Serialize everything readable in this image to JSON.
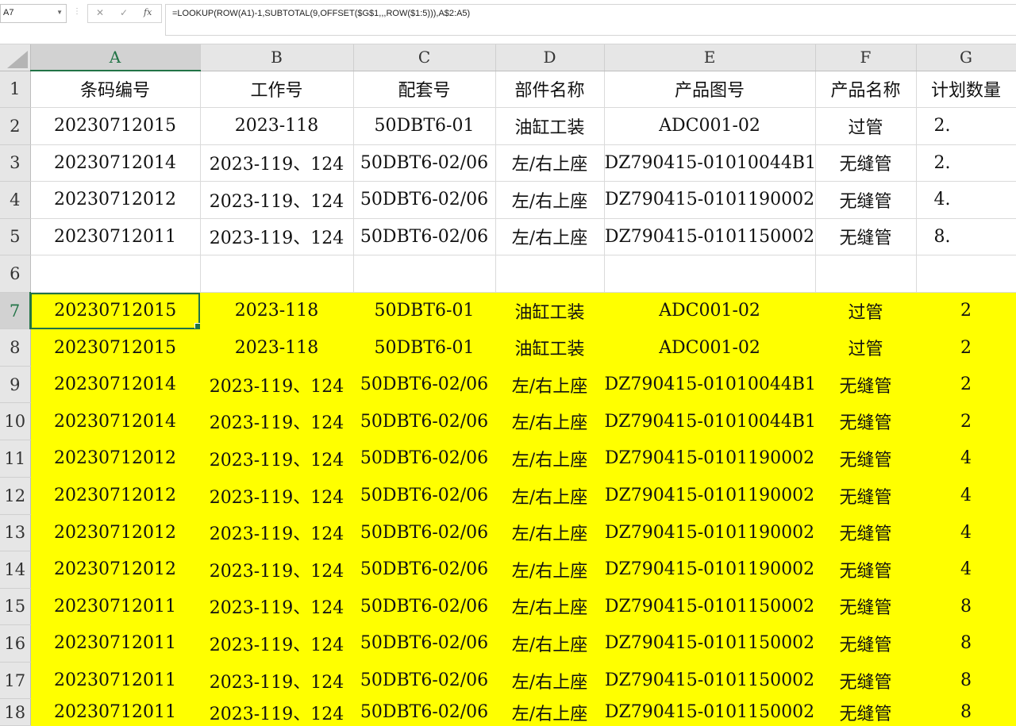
{
  "formula_bar": {
    "name_box": "A7",
    "cancel_icon": "✕",
    "enter_icon": "✓",
    "function_icon": "fx",
    "formula": "=LOOKUP(ROW(A1)-1,SUBTOTAL(9,OFFSET($G$1,,,ROW($1:5))),A$2:A5)"
  },
  "columns": [
    "A",
    "B",
    "C",
    "D",
    "E",
    "F",
    "G"
  ],
  "active_column": "A",
  "active_row": "7",
  "rows": [
    {
      "num": "1",
      "highlight": false,
      "cells": [
        "条码编号",
        "工作号",
        "配套号",
        "部件名称",
        "产品图号",
        "产品名称",
        "计划数量"
      ]
    },
    {
      "num": "2",
      "highlight": false,
      "cells": [
        "20230712015",
        "2023-118",
        "50DBT6-01",
        "油缸工装",
        "ADC001-02",
        "过管",
        "2."
      ]
    },
    {
      "num": "3",
      "highlight": false,
      "cells": [
        "20230712014",
        "2023-119、124",
        "50DBT6-02/06",
        "左/右上座",
        "DZ790415-01010044B1",
        "无缝管",
        "2."
      ]
    },
    {
      "num": "4",
      "highlight": false,
      "cells": [
        "20230712012",
        "2023-119、124",
        "50DBT6-02/06",
        "左/右上座",
        "DZ790415-0101190002",
        "无缝管",
        "4."
      ]
    },
    {
      "num": "5",
      "highlight": false,
      "cells": [
        "20230712011",
        "2023-119、124",
        "50DBT6-02/06",
        "左/右上座",
        "DZ790415-0101150002",
        "无缝管",
        "8."
      ]
    },
    {
      "num": "6",
      "highlight": false,
      "cells": [
        "",
        "",
        "",
        "",
        "",
        "",
        ""
      ]
    },
    {
      "num": "7",
      "highlight": true,
      "cells": [
        "20230712015",
        "2023-118",
        "50DBT6-01",
        "油缸工装",
        "ADC001-02",
        "过管",
        "2"
      ]
    },
    {
      "num": "8",
      "highlight": true,
      "cells": [
        "20230712015",
        "2023-118",
        "50DBT6-01",
        "油缸工装",
        "ADC001-02",
        "过管",
        "2"
      ]
    },
    {
      "num": "9",
      "highlight": true,
      "cells": [
        "20230712014",
        "2023-119、124",
        "50DBT6-02/06",
        "左/右上座",
        "DZ790415-01010044B1",
        "无缝管",
        "2"
      ]
    },
    {
      "num": "10",
      "highlight": true,
      "cells": [
        "20230712014",
        "2023-119、124",
        "50DBT6-02/06",
        "左/右上座",
        "DZ790415-01010044B1",
        "无缝管",
        "2"
      ]
    },
    {
      "num": "11",
      "highlight": true,
      "cells": [
        "20230712012",
        "2023-119、124",
        "50DBT6-02/06",
        "左/右上座",
        "DZ790415-0101190002",
        "无缝管",
        "4"
      ]
    },
    {
      "num": "12",
      "highlight": true,
      "cells": [
        "20230712012",
        "2023-119、124",
        "50DBT6-02/06",
        "左/右上座",
        "DZ790415-0101190002",
        "无缝管",
        "4"
      ]
    },
    {
      "num": "13",
      "highlight": true,
      "cells": [
        "20230712012",
        "2023-119、124",
        "50DBT6-02/06",
        "左/右上座",
        "DZ790415-0101190002",
        "无缝管",
        "4"
      ]
    },
    {
      "num": "14",
      "highlight": true,
      "cells": [
        "20230712012",
        "2023-119、124",
        "50DBT6-02/06",
        "左/右上座",
        "DZ790415-0101190002",
        "无缝管",
        "4"
      ]
    },
    {
      "num": "15",
      "highlight": true,
      "cells": [
        "20230712011",
        "2023-119、124",
        "50DBT6-02/06",
        "左/右上座",
        "DZ790415-0101150002",
        "无缝管",
        "8"
      ]
    },
    {
      "num": "16",
      "highlight": true,
      "cells": [
        "20230712011",
        "2023-119、124",
        "50DBT6-02/06",
        "左/右上座",
        "DZ790415-0101150002",
        "无缝管",
        "8"
      ]
    },
    {
      "num": "17",
      "highlight": true,
      "cells": [
        "20230712011",
        "2023-119、124",
        "50DBT6-02/06",
        "左/右上座",
        "DZ790415-0101150002",
        "无缝管",
        "8"
      ]
    },
    {
      "num": "18",
      "highlight": true,
      "cells": [
        "20230712011",
        "2023-119、124",
        "50DBT6-02/06",
        "左/右上座",
        "DZ790415-0101150002",
        "无缝管",
        "8"
      ]
    }
  ],
  "colors": {
    "highlight": "#ffff00",
    "accent": "#217346",
    "header_bg": "#e6e6e6"
  }
}
